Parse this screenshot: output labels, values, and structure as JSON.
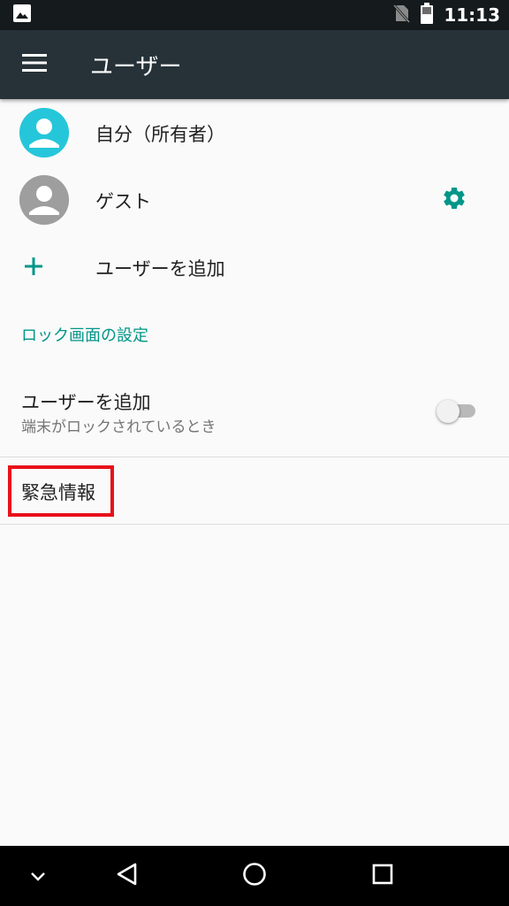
{
  "status_bar": {
    "time": "11:13",
    "icons": [
      "image-notification-icon",
      "no-sim-icon",
      "battery-icon"
    ]
  },
  "app_bar": {
    "title": "ユーザー",
    "menu_icon": "hamburger-menu-icon",
    "background": "#263238"
  },
  "users": [
    {
      "label": "自分（所有者）",
      "avatar_color": "#26c6da",
      "icon": "avatar-icon"
    },
    {
      "label": "ゲスト",
      "avatar_color": "#9e9e9e",
      "icon": "avatar-icon",
      "action_icon": "gear-icon"
    }
  ],
  "add_user": {
    "label": "ユーザーを追加",
    "icon": "plus-icon"
  },
  "lock_screen_section": {
    "header": "ロック画面の設定",
    "preference": {
      "title": "ユーザーを追加",
      "summary": "端末がロックされているとき",
      "enabled": false
    }
  },
  "emergency": {
    "label": "緊急情報",
    "highlight_color": "#e8101a"
  },
  "nav_bar": {
    "buttons": [
      "hide-keyboard-icon",
      "back-icon",
      "home-icon",
      "recents-icon"
    ]
  },
  "colors": {
    "accent": "#009688",
    "page_bg": "#fafafa"
  }
}
